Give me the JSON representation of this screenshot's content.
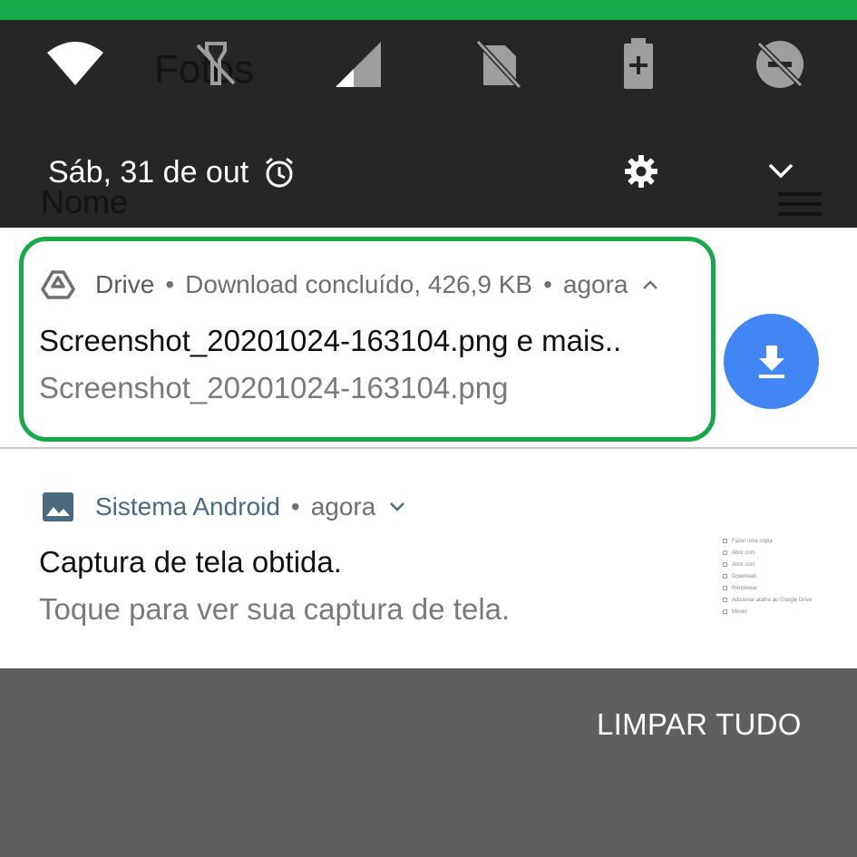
{
  "status_bar": {
    "accent_color": "#16a94a"
  },
  "quick_settings": {
    "icons": [
      "wifi-icon",
      "flashlight-off-icon",
      "signal-icon",
      "no-sim-icon",
      "battery-saver-icon",
      "do-not-disturb-off-icon"
    ],
    "date": "Sáb, 31 de out",
    "alarm_icon": "alarm-icon",
    "settings_icon": "gear-icon",
    "expand_icon": "chevron-down-icon"
  },
  "background_app": {
    "title": "Fotos",
    "sort_label": "Nome"
  },
  "notifications": [
    {
      "app": "Drive",
      "status": "Download concluído, 426,9 KB",
      "time": "agora",
      "title": "Screenshot_20201024-163104.png e mais..",
      "text": "Screenshot_20201024-163104.png",
      "action_icon": "download-icon",
      "action_color": "#4285f4",
      "expanded": true
    },
    {
      "app": "Sistema Android",
      "time": "agora",
      "title": "Captura de tela obtida.",
      "text": "Toque para ver sua captura de tela.",
      "expanded": false,
      "thumbnail_items": [
        "Fazer uma cópia",
        "Abrir com",
        "Abrir com",
        "Download",
        "Renomear",
        "Adicionar atalho ao Google Drive",
        "Mover"
      ]
    }
  ],
  "footer": {
    "clear_all": "LIMPAR TUDO"
  }
}
